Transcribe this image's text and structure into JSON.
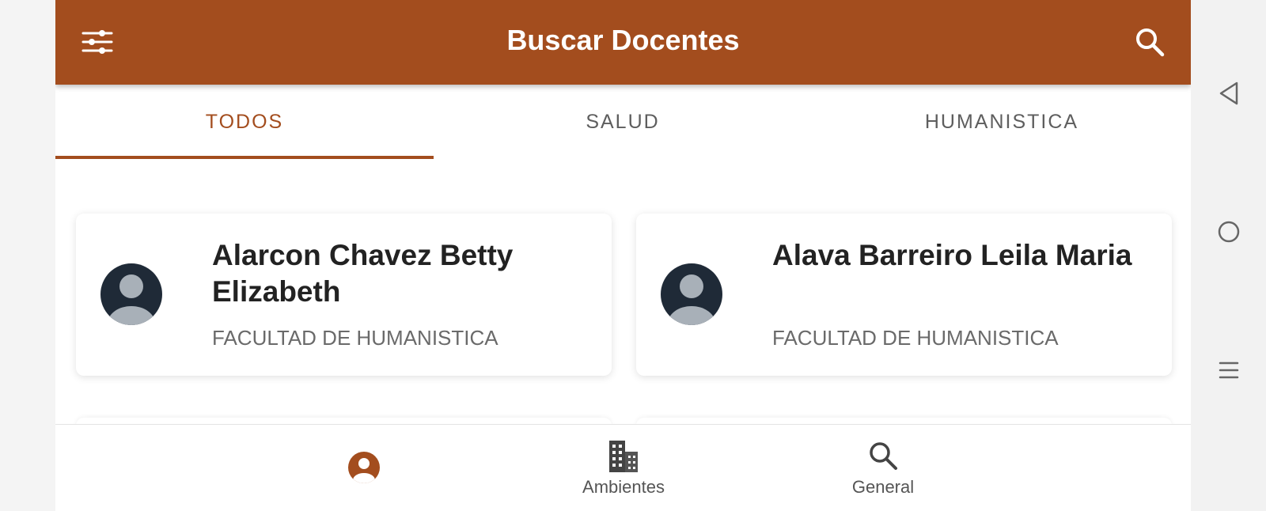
{
  "header": {
    "title": "Buscar Docentes",
    "filter_icon": "tune-icon",
    "search_icon": "search-icon"
  },
  "tabs": [
    {
      "label": "TODOS",
      "active": true
    },
    {
      "label": "SALUD",
      "active": false
    },
    {
      "label": "HUMANISTICA",
      "active": false
    }
  ],
  "teachers": [
    {
      "name": "Alarcon Chavez Betty Elizabeth",
      "faculty": "FACULTAD DE HUMANISTICA",
      "avatar_icon": "person-avatar-icon"
    },
    {
      "name": "Alava Barreiro Leila Maria",
      "faculty": "FACULTAD DE HUMANISTICA",
      "avatar_icon": "person-avatar-icon"
    }
  ],
  "bottom_nav": [
    {
      "label": "",
      "icon": "account-circle-icon",
      "active": true
    },
    {
      "label": "Ambientes",
      "icon": "building-icon",
      "active": false
    },
    {
      "label": "General",
      "icon": "search-icon",
      "active": false
    }
  ],
  "system_nav": {
    "back_icon": "back-triangle-icon",
    "home_icon": "home-circle-icon",
    "recents_icon": "menu-lines-icon"
  },
  "colors": {
    "primary": "#a34d1e",
    "avatar_bg": "#1f2a37",
    "avatar_fg": "#a8b0b8",
    "inactive_text": "#5e5e5e"
  }
}
